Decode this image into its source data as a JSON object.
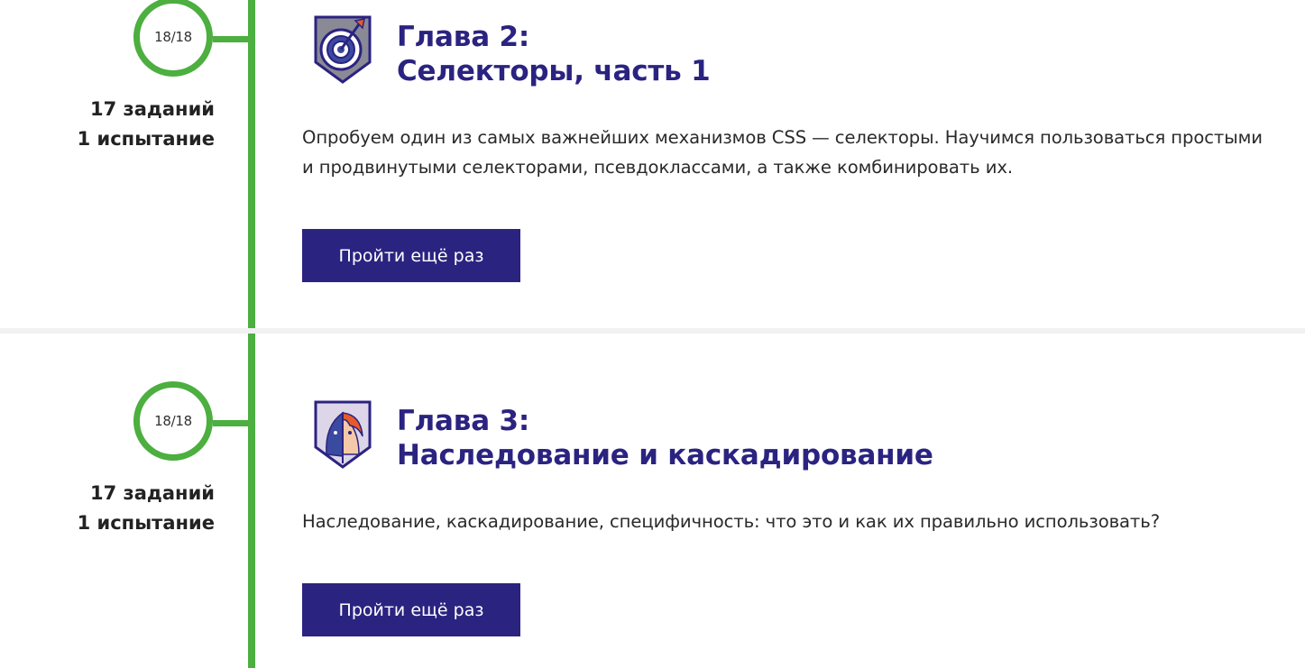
{
  "chapters": [
    {
      "progress": "18/18",
      "stats": {
        "tasks": "17 заданий",
        "tests": "1 испытание"
      },
      "badge_icon": "target-dart-shield-icon",
      "title_line1": "Глава 2:",
      "title_line2": "Селекторы, часть 1",
      "description": "Опробуем один из самых важнейших механизмов CSS — селекторы. Научимся пользоваться простыми и продвинутыми селекторами, псевдоклассами, а также комбинировать их.",
      "button_label": "Пройти ещё раз"
    },
    {
      "progress": "18/18",
      "stats": {
        "tasks": "17 заданий",
        "tests": "1 испытание"
      },
      "badge_icon": "father-son-portrait-shield-icon",
      "title_line1": "Глава 3:",
      "title_line2": "Наследование и каскадирование",
      "description": "Наследование, каскадирование, специфичность: что это и как их правильно использовать?",
      "button_label": "Пройти ещё раз"
    }
  ],
  "colors": {
    "accent": "#2b2380",
    "timeline": "#4caf3f",
    "text": "#222222"
  }
}
